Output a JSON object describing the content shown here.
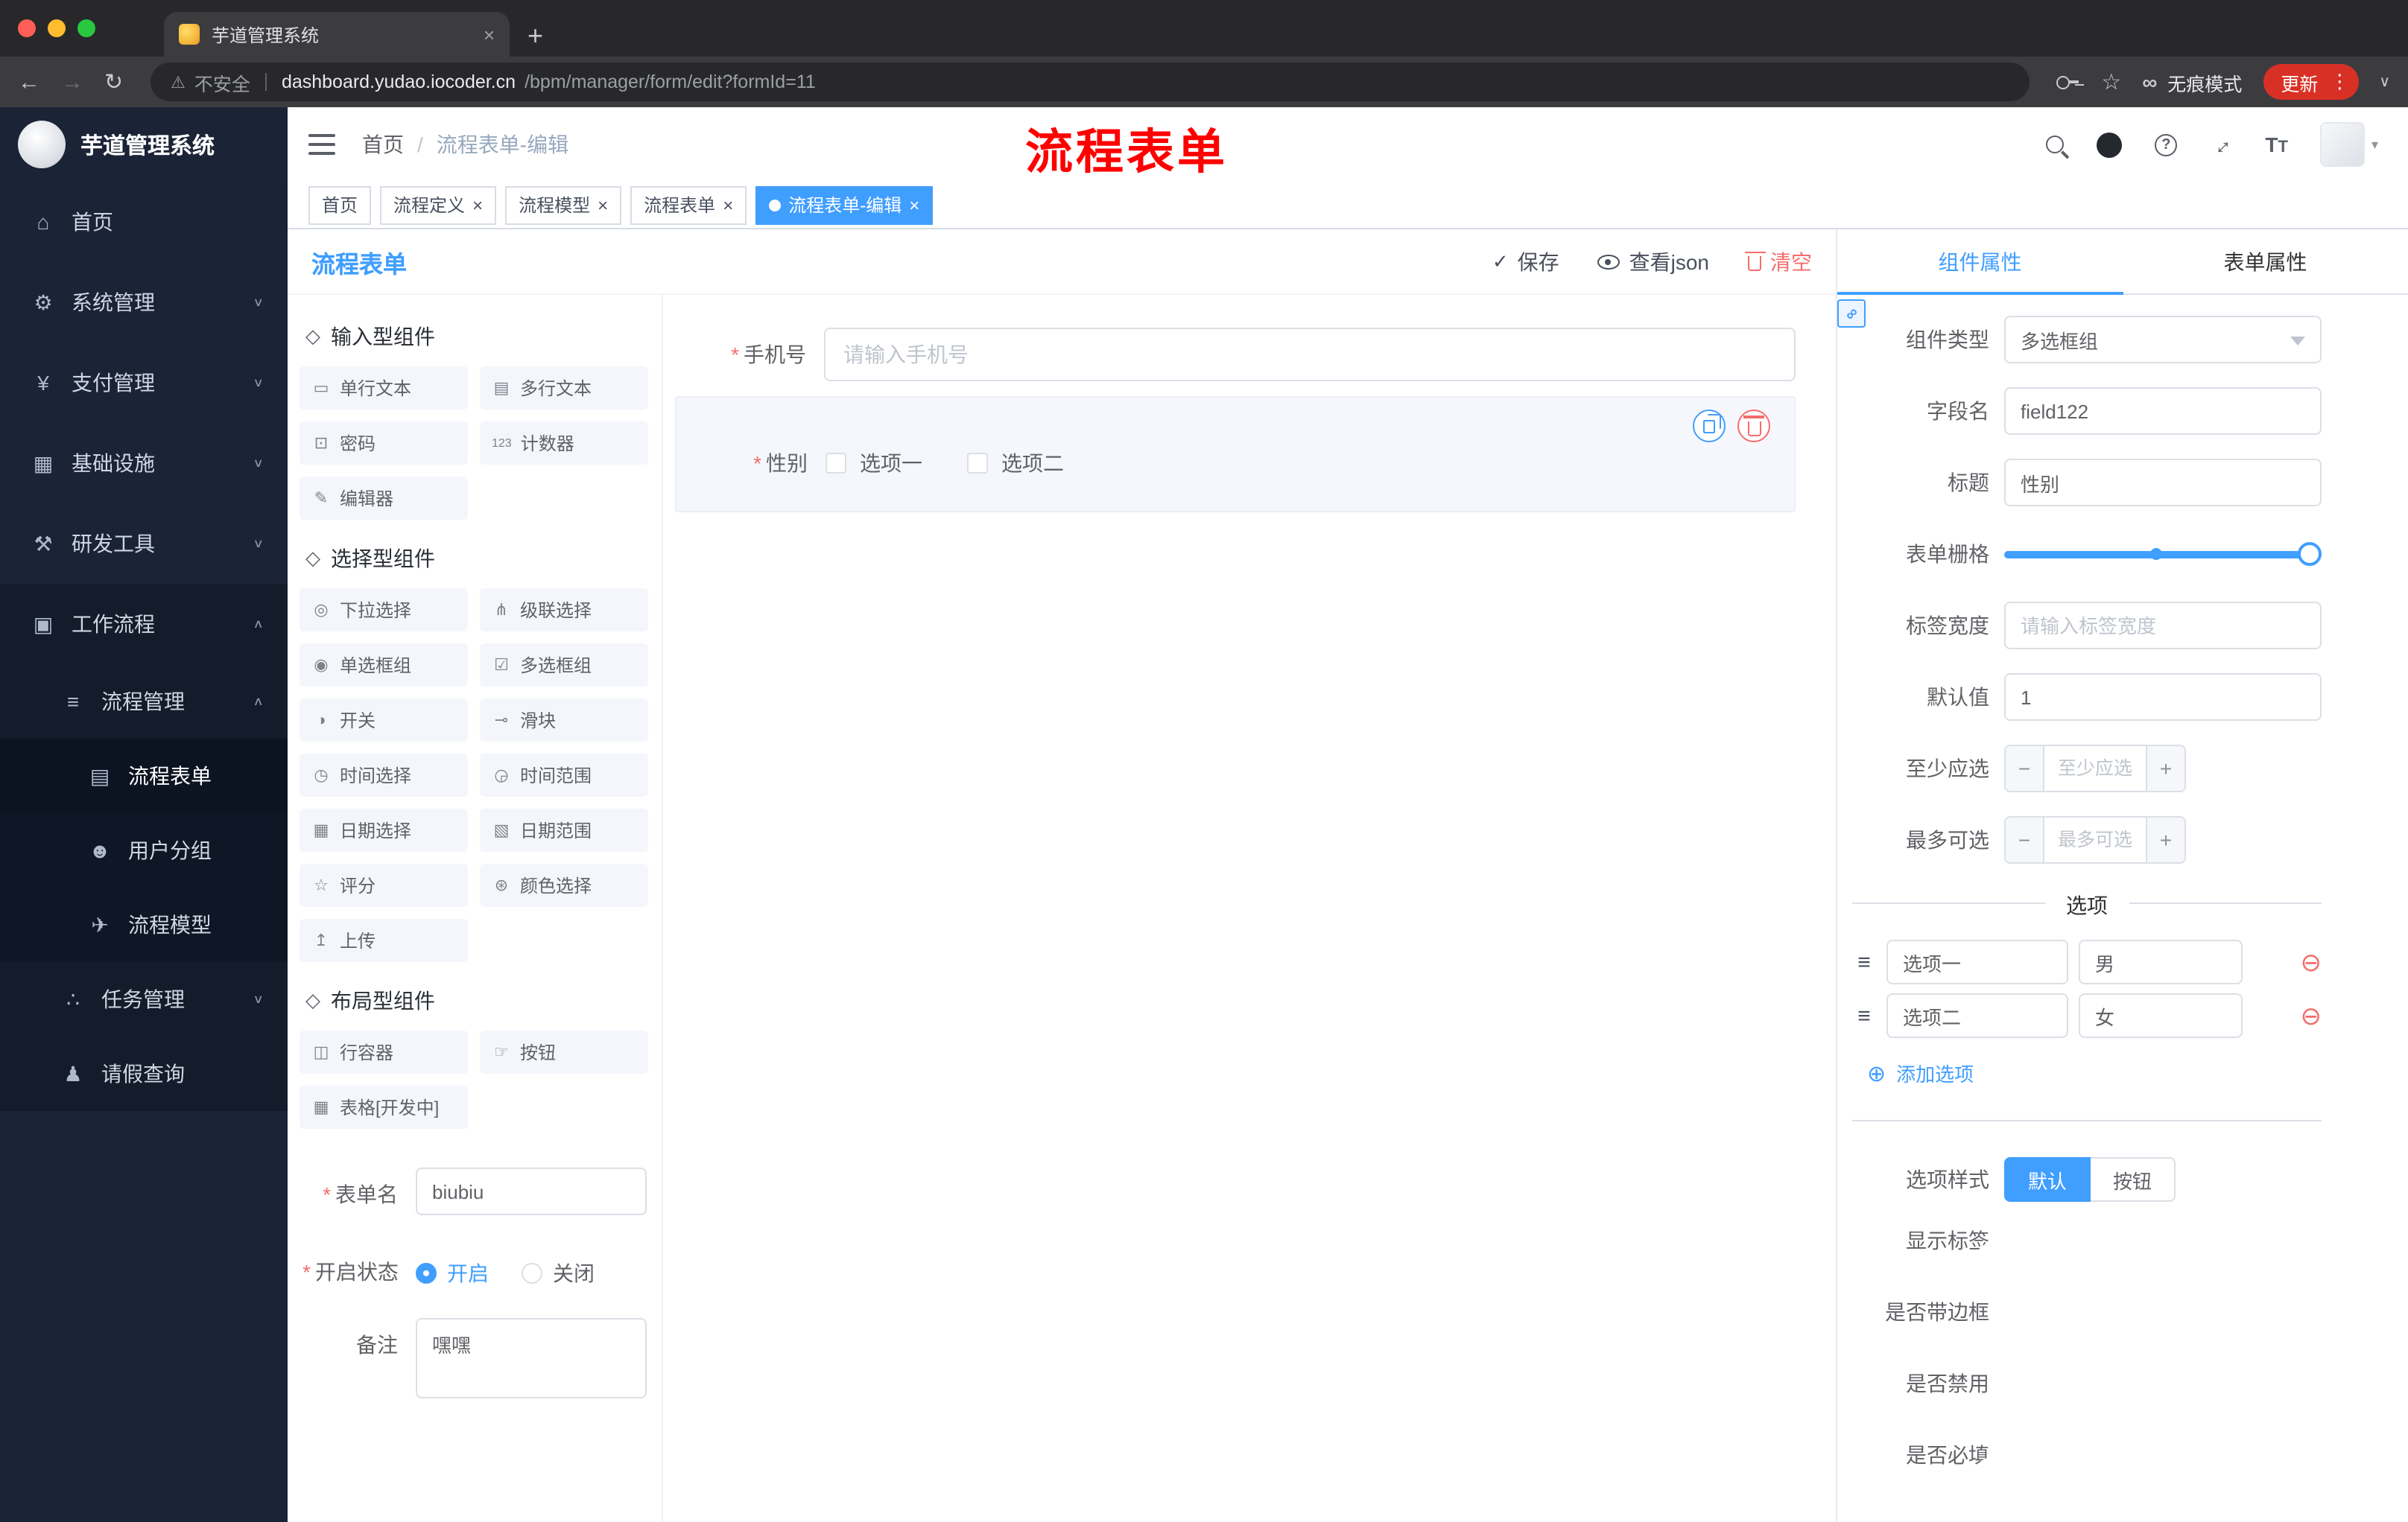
{
  "colors": {
    "accent": "#409eff",
    "danger": "#f56c6c",
    "annotation": "#ff0000",
    "sidebar_bg": "#1b2436",
    "update_button": "#d93025"
  },
  "icons": {
    "back": "←",
    "forward": "→",
    "reload": "↻",
    "warning": "⚠",
    "star": "☆",
    "incognito": "∞",
    "menu_dots": "⋮",
    "chevron_small": "∨",
    "plus": "+",
    "close": "×",
    "question": "?",
    "fullscreen_arrow": "↔",
    "font_big": "T",
    "font_small": "T",
    "caret_down": "▾",
    "slash": "/",
    "check": "✓",
    "minus": "−",
    "plus_sign": "+",
    "minus_circle": "⊖",
    "plus_circle": "⊕",
    "drag": "≡",
    "link": "∞",
    "chevron_up": "∧",
    "chevron_down": "∨",
    "section_hand": "◇",
    "active_dot": ""
  },
  "browser": {
    "tab_title": "芋道管理系统",
    "security_label": "不安全",
    "url_domain": "dashboard.yudao.iocoder.cn",
    "url_path": "/bpm/manager/form/edit?formId=11",
    "incognito_label": "无痕模式",
    "update_label": "更新"
  },
  "sidebar": {
    "logo_title": "芋道管理系统",
    "items": [
      {
        "label": "首页",
        "icon": "⌂"
      },
      {
        "label": "系统管理",
        "icon": "⚙"
      },
      {
        "label": "支付管理",
        "icon": "¥"
      },
      {
        "label": "基础设施",
        "icon": "▦"
      },
      {
        "label": "研发工具",
        "icon": "⚒"
      },
      {
        "label": "工作流程",
        "icon": "▣"
      },
      {
        "label": "流程管理",
        "icon": "≡"
      },
      {
        "label": "流程表单",
        "icon": "▤"
      },
      {
        "label": "用户分组",
        "icon": "☻"
      },
      {
        "label": "流程模型",
        "icon": "✈"
      },
      {
        "label": "任务管理",
        "icon": "∴"
      },
      {
        "label": "请假查询",
        "icon": "♟"
      }
    ]
  },
  "header": {
    "breadcrumb_home": "首页",
    "breadcrumb_current": "流程表单-编辑",
    "annotation": "流程表单"
  },
  "tags": [
    {
      "label": "首页"
    },
    {
      "label": "流程定义"
    },
    {
      "label": "流程模型"
    },
    {
      "label": "流程表单"
    },
    {
      "label": "流程表单-编辑"
    }
  ],
  "designer": {
    "title": "流程表单",
    "save_label": "保存",
    "view_json_label": "查看json",
    "clear_label": "清空"
  },
  "palette": {
    "sections": [
      {
        "title": "输入型组件",
        "items": [
          {
            "label": "单行文本",
            "icon": "▭"
          },
          {
            "label": "多行文本",
            "icon": "▤"
          },
          {
            "label": "密码",
            "icon": "⊡"
          },
          {
            "label": "计数器",
            "icon": "123"
          },
          {
            "label": "编辑器",
            "icon": "✎"
          }
        ]
      },
      {
        "title": "选择型组件",
        "items": [
          {
            "label": "下拉选择",
            "icon": "◎"
          },
          {
            "label": "级联选择",
            "icon": "⋔"
          },
          {
            "label": "单选框组",
            "icon": "◉"
          },
          {
            "label": "多选框组",
            "icon": "☑"
          },
          {
            "label": "开关",
            "icon": "◑"
          },
          {
            "label": "滑块",
            "icon": "⊸"
          },
          {
            "label": "时间选择",
            "icon": "◷"
          },
          {
            "label": "时间范围",
            "icon": "◶"
          },
          {
            "label": "日期选择",
            "icon": "▦"
          },
          {
            "label": "日期范围",
            "icon": "▧"
          },
          {
            "label": "评分",
            "icon": "☆"
          },
          {
            "label": "颜色选择",
            "icon": "⊛"
          },
          {
            "label": "上传",
            "icon": "↥"
          }
        ]
      },
      {
        "title": "布局型组件",
        "items": [
          {
            "label": "行容器",
            "icon": "◫"
          },
          {
            "label": "按钮",
            "icon": "☞"
          },
          {
            "label": "表格[开发中]",
            "icon": "▦"
          }
        ]
      }
    ]
  },
  "form_meta": {
    "name_label": "表单名",
    "name_value": "biubiu",
    "status_label": "开启状态",
    "on_label": "开启",
    "off_label": "关闭",
    "remark_label": "备注",
    "remark_value": "嘿嘿"
  },
  "canvas": {
    "phone": {
      "label": "手机号",
      "placeholder": "请输入手机号"
    },
    "gender": {
      "label": "性别",
      "option1": "选项一",
      "option2": "选项二"
    }
  },
  "props": {
    "tabs": {
      "component": "组件属性",
      "form": "表单属性"
    },
    "component_type": {
      "label": "组件类型",
      "value": "多选框组"
    },
    "field_name": {
      "label": "字段名",
      "value": "field122"
    },
    "title": {
      "label": "标题",
      "value": "性别"
    },
    "grid": {
      "label": "表单栅格"
    },
    "label_width": {
      "label": "标签宽度",
      "placeholder": "请输入标签宽度"
    },
    "default_value": {
      "label": "默认值",
      "value": "1"
    },
    "min_count": {
      "label": "至少应选",
      "placeholder": "至少应选"
    },
    "max_count": {
      "label": "最多可选",
      "placeholder": "最多可选"
    },
    "options": {
      "divider": "选项",
      "rows": [
        {
          "name": "选项一",
          "value": "男"
        },
        {
          "name": "选项二",
          "value": "女"
        }
      ],
      "add_label": "添加选项"
    },
    "option_style": {
      "label": "选项样式",
      "opt_default": "默认",
      "opt_button": "按钮",
      "selected": "默认"
    },
    "show_label": {
      "label": "显示标签",
      "on": true
    },
    "border": {
      "label": "是否带边框",
      "on": false
    },
    "disabled": {
      "label": "是否禁用",
      "on": false
    },
    "required": {
      "label": "是否必填",
      "on": true
    }
  }
}
